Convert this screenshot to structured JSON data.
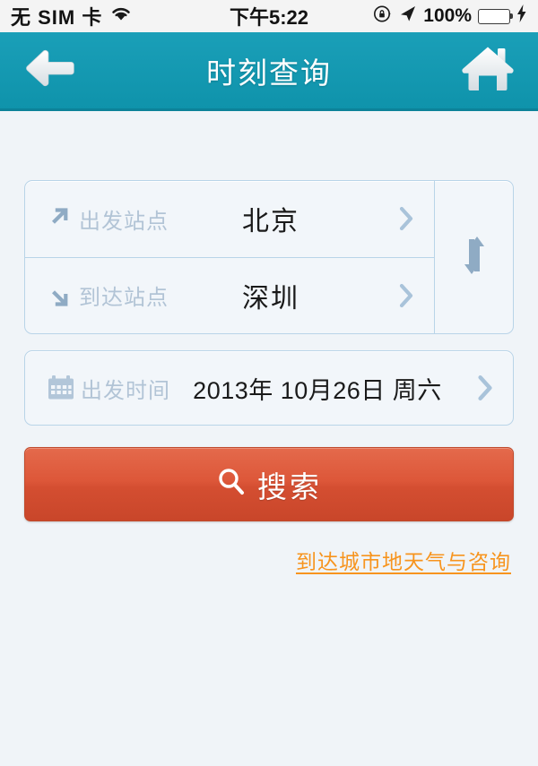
{
  "statusbar": {
    "carrier": "无 SIM 卡",
    "wifi_icon": "wifi-icon",
    "time": "下午5:22",
    "rotation_lock_icon": "rotation-lock-icon",
    "location_icon": "location-arrow-icon",
    "battery_percent": "100%",
    "battery_icon": "battery-icon",
    "charging_icon": "lightning-bolt-icon",
    "battery_color": "#4cd55c"
  },
  "header": {
    "title": "时刻查询",
    "back_icon": "back-arrow-icon",
    "home_icon": "home-icon",
    "background_color": "#0f93ab"
  },
  "form": {
    "departure": {
      "icon": "arrow-up-right-icon",
      "label": "出发站点",
      "value": "北京",
      "chevron_icon": "chevron-right-icon"
    },
    "arrival": {
      "icon": "arrow-down-right-icon",
      "label": "到达站点",
      "value": "深圳",
      "chevron_icon": "chevron-right-icon"
    },
    "swap": {
      "icon": "swap-vertical-icon"
    },
    "date": {
      "icon": "calendar-icon",
      "label": "出发时间",
      "value": "2013年 10月26日 周六",
      "chevron_icon": "chevron-right-icon"
    }
  },
  "actions": {
    "search_label": "搜索",
    "search_icon": "magnifier-icon",
    "search_color": "#d44e31",
    "weather_link": "到达城市地天气与咨询",
    "weather_link_color": "#f7941e"
  }
}
